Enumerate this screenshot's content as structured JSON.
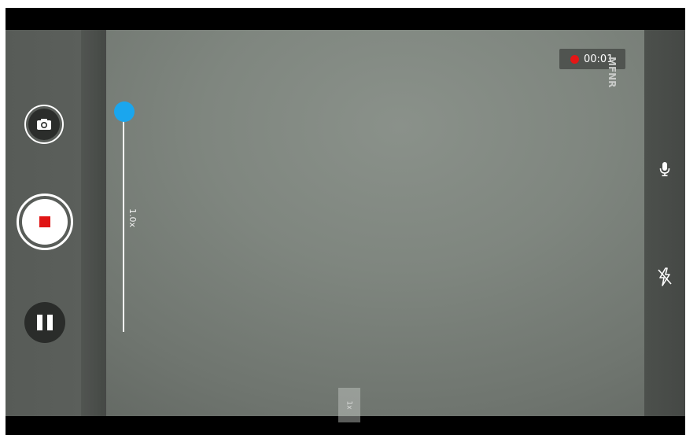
{
  "recording": {
    "elapsed": "00:01",
    "indicator_color": "#e51616"
  },
  "overlay": {
    "mode_label": "MFNR"
  },
  "zoom": {
    "slider_label": "1.0x",
    "chip_label": "1x",
    "knob_color": "#1aa6ee"
  },
  "controls": {
    "snapshot_icon": "camera-icon",
    "record_icon": "stop-icon",
    "pause_icon": "pause-icon",
    "mic_icon": "microphone-icon",
    "flash_icon": "flash-off-icon"
  }
}
